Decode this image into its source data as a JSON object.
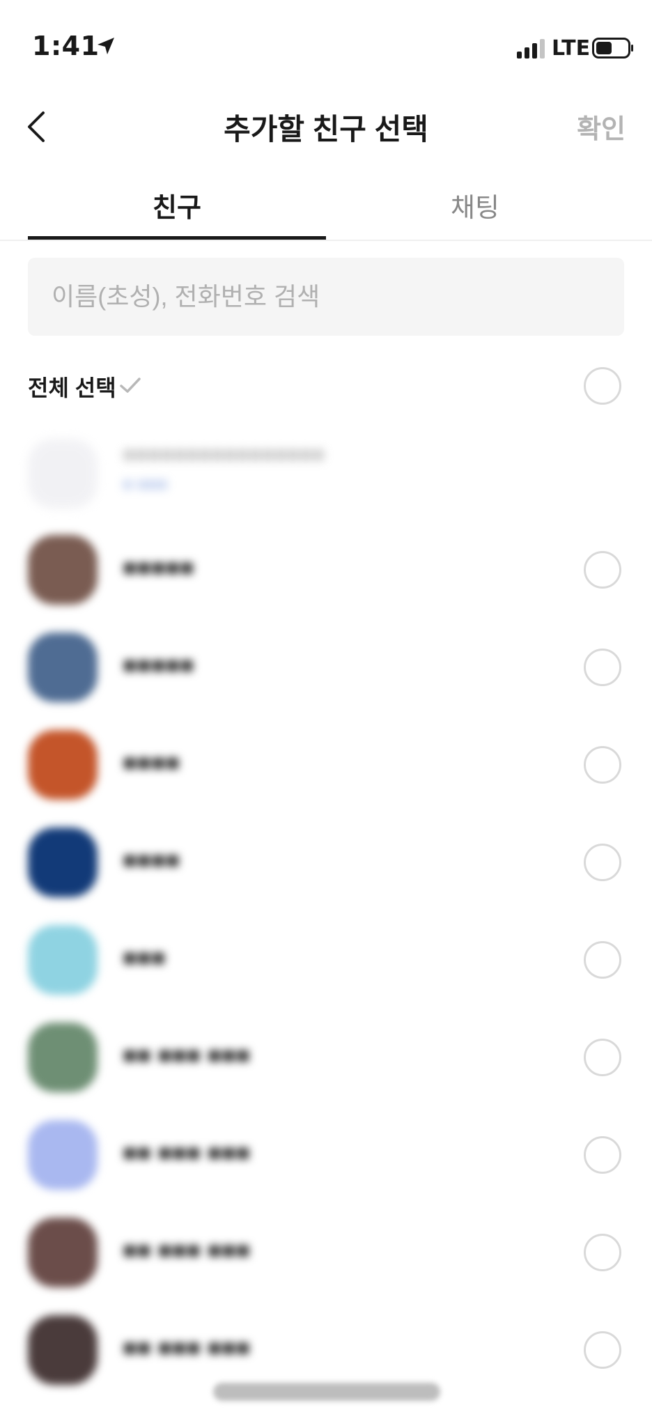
{
  "status_bar": {
    "time": "1:41",
    "network": "LTE",
    "icons": [
      "location-arrow-icon",
      "signal-icon",
      "battery-icon"
    ]
  },
  "header": {
    "title": "추가할 친구 선택",
    "confirm_label": "확인",
    "back_icon": "chevron-left-icon"
  },
  "tabs": [
    {
      "label": "친구",
      "selected": true
    },
    {
      "label": "채팅",
      "selected": false
    }
  ],
  "search": {
    "placeholder": "이름(초성), 전화번호 검색",
    "value": ""
  },
  "select_all": {
    "label": "전체 선택",
    "checked": false
  },
  "me": {
    "name": "■■■■■■■■■■■■■■■■",
    "sub": "■ ■■■"
  },
  "friends": [
    {
      "name": "■■■■■",
      "avatar_color": "#7a5c52"
    },
    {
      "name": "■■■■■",
      "avatar_color": "#4f6c93"
    },
    {
      "name": "■■■■",
      "avatar_color": "#c4552a"
    },
    {
      "name": "■■■■",
      "avatar_color": "#123a78"
    },
    {
      "name": "■■■",
      "avatar_color": "#8fd3e2"
    },
    {
      "name": "■■ ■■■ ■■■",
      "avatar_color": "#6e8f74"
    },
    {
      "name": "■■ ■■■ ■■■",
      "avatar_color": "#a9b8f0"
    },
    {
      "name": "■■ ■■■ ■■■",
      "avatar_color": "#6b4d4a"
    },
    {
      "name": "■■ ■■■ ■■■",
      "avatar_color": "#4a3b3b"
    }
  ],
  "colors": {
    "accent": "#191919",
    "muted_text": "#888888",
    "disabled_text": "#b3b3b3",
    "search_bg": "#f5f5f5",
    "circle_border": "#d9d9d9"
  }
}
